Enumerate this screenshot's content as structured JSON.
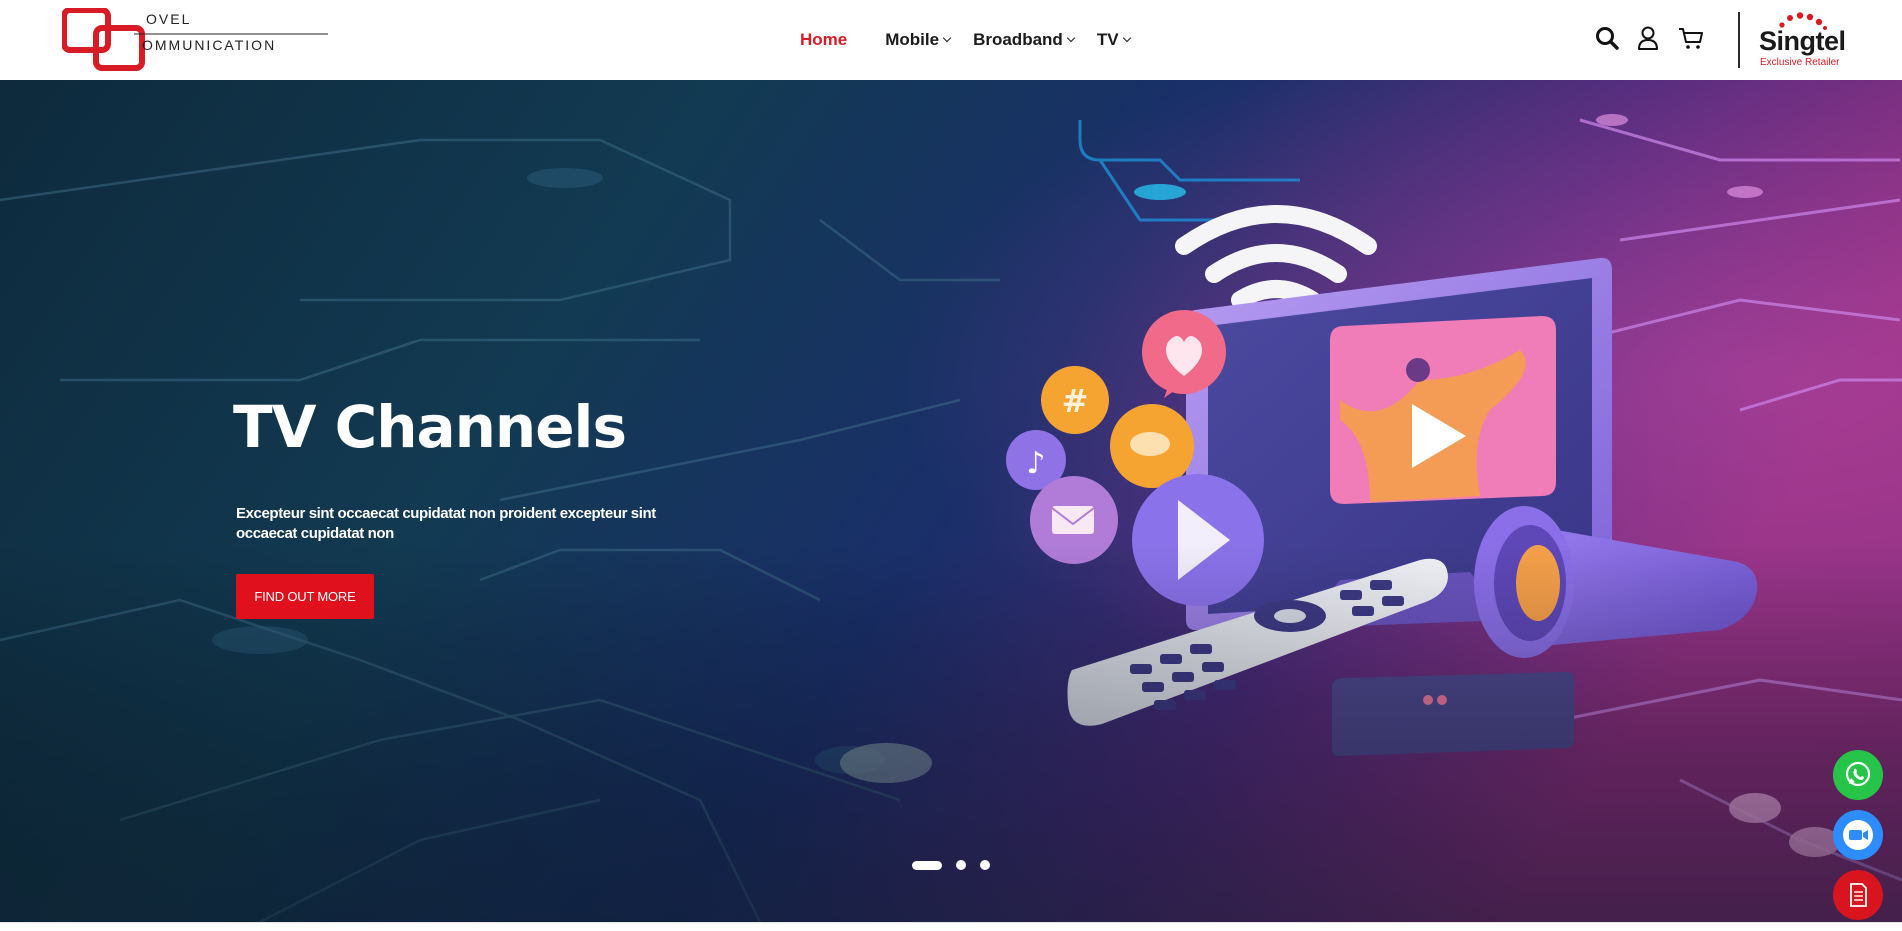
{
  "brand": {
    "logo_line1": "OVEL",
    "logo_line2": "OMMUNICATION",
    "colors": {
      "accent": "#d81b24",
      "text": "#1b1b1b"
    }
  },
  "nav": {
    "items": [
      {
        "label": "Home",
        "active": true,
        "has_dropdown": false
      },
      {
        "label": "Mobile",
        "has_dropdown": true
      },
      {
        "label": "Broadband",
        "has_dropdown": true
      },
      {
        "label": "TV",
        "has_dropdown": true
      }
    ]
  },
  "header_icons": [
    "search-icon",
    "user-icon",
    "cart-icon"
  ],
  "partner": {
    "name": "Singtel",
    "tagline": "Exclusive Retailer"
  },
  "hero": {
    "title": "TV Channels",
    "text": "Excepteur sint occaecat cupidatat non proident excepteur sint occaecat cupidatat non",
    "cta_label": "FIND OUT MORE",
    "cta_color": "#e0111d",
    "slides": {
      "count": 3,
      "active": 1
    }
  },
  "floating_buttons": [
    {
      "icon": "whatsapp-icon",
      "color": "#27c44a"
    },
    {
      "icon": "video-call-icon",
      "color": "#2d8cff"
    },
    {
      "icon": "document-icon",
      "color": "#d8141f"
    }
  ]
}
